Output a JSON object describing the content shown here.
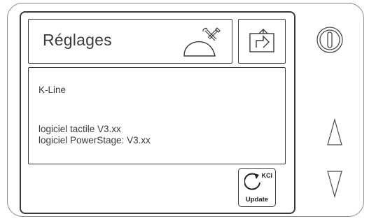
{
  "header": {
    "title": "Réglages"
  },
  "info": {
    "device_name": "K-Line",
    "touch_software": "logiciel tactile V3.xx",
    "powerstage_software": "logiciel PowerStage: V3.xx"
  },
  "kci_button": {
    "badge": "KCI",
    "label": "Update"
  },
  "icons": {
    "settings": "settings-tools-icon",
    "export": "export-icon",
    "power": "power-icon",
    "up": "triangle-up-icon",
    "down": "triangle-down-icon",
    "update": "rotate-arrow-icon"
  },
  "colors": {
    "line": "#3a3a3a",
    "frame": "#8a8a8a"
  }
}
